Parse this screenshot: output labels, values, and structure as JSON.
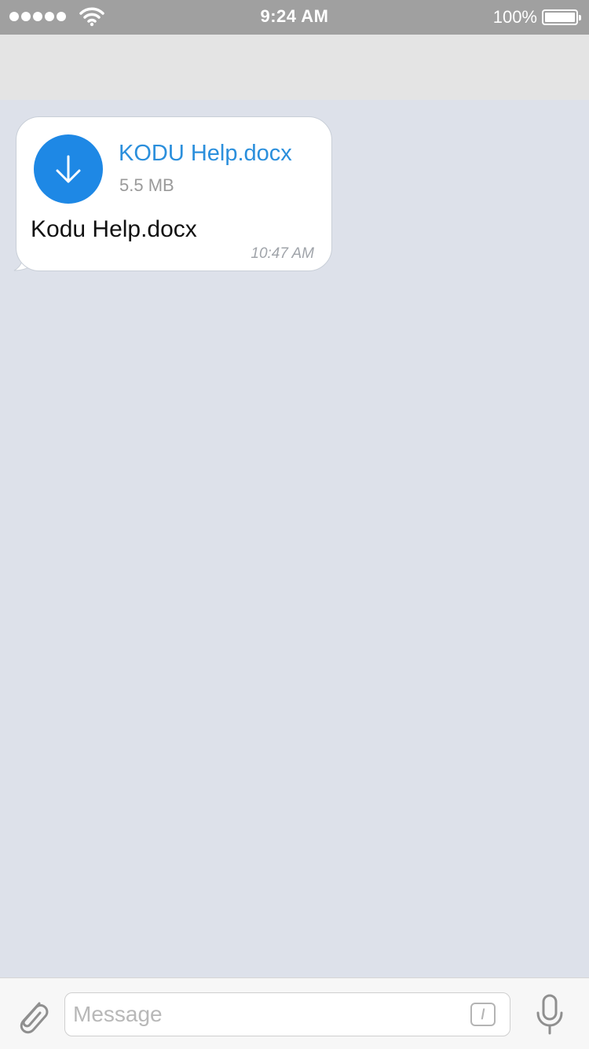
{
  "status_bar": {
    "time": "9:24 AM",
    "battery_percent": "100%",
    "signal_bars": 5,
    "icons": [
      "signal-dots-icon",
      "wifi-icon",
      "battery-icon"
    ]
  },
  "message": {
    "file_name": "KODU Help.docx",
    "file_size": "5.5 MB",
    "caption": "Kodu Help.docx",
    "time": "10:47 AM",
    "icon": "download-arrow-icon"
  },
  "input_bar": {
    "placeholder": "Message",
    "command_label": "/",
    "icons": [
      "paperclip-icon",
      "command-slash-icon",
      "microphone-icon"
    ]
  },
  "colors": {
    "status_bar_bg": "#a0a0a0",
    "header_bg": "#e4e4e4",
    "chat_bg": "#dde1ea",
    "accent": "#1e88e5",
    "file_name": "#2b8fdc"
  }
}
